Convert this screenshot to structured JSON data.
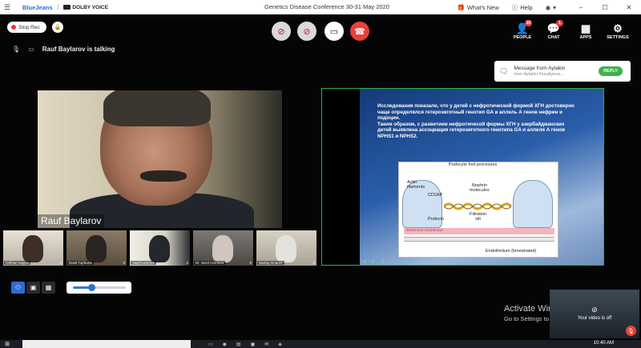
{
  "titlebar": {
    "menu_icon": "menu-icon",
    "brand": "BlueJeans",
    "separator": "|",
    "dolby": "DOLBY VOICE",
    "title": "Genetics Disease Conference 30-31 May 2020",
    "whats_new": "What's New",
    "help": "Help",
    "min": "–",
    "max": "☐",
    "close": "✕"
  },
  "controls": {
    "stop_rec": "Stop Rec",
    "talking": "Rauf Baylarov is talking",
    "people": {
      "label": "PEOPLE",
      "badge": "10"
    },
    "chat": {
      "label": "CHAT",
      "badge": "1"
    },
    "apps": {
      "label": "APPS"
    },
    "settings": {
      "label": "SETTINGS"
    }
  },
  "notification": {
    "title": "Message from Aytakin",
    "message": "men Aytakin Nuraliyeva...",
    "reply": "REPLY"
  },
  "speaker": {
    "name": "Rauf Baylarov"
  },
  "participants": [
    {
      "name": "Orkhan Isayev",
      "no": "2"
    },
    {
      "name": "Davit Tophuria",
      "no": "3"
    },
    {
      "name": "Vaqif Karimov",
      "no": "4"
    },
    {
      "name": "Dr. Sevil Azimova",
      "no": "6"
    },
    {
      "name": "Namiq Xinarov",
      "no": "8"
    }
  ],
  "zoom_level": 0.35,
  "slide": {
    "p1": "Исследования показали, что у детей с нефротической формой ХГН  достоверно чаще определялся гетерозиготный генотип GA и аллель А генов нефрин и подоцин.",
    "p2": "Таким образом, с развитием нефротичесой формы ХГН у азербайджанских детей выявлена ассоциация гетерозиготного генотипа GA и аллеля A генов NPHS1 и NPHS2.",
    "diagram": {
      "podocyte_foot": "Podocyte foot processes",
      "actin": "Actin\nfilaments",
      "cd2ap": "CD2AP",
      "nephrin": "Nephrin\nmolecules",
      "podocin": "Podocin",
      "filtration": "Filtration\nslit",
      "basement": "Basement membrane",
      "endothelium": "Endothelium (fenestrated)"
    }
  },
  "watermark": {
    "line1": "Activate Windows",
    "line2": "Go to Settings to activate Windows."
  },
  "selfview": {
    "text": "Your video is off"
  },
  "taskbar": {
    "time": "10:40 AM"
  }
}
